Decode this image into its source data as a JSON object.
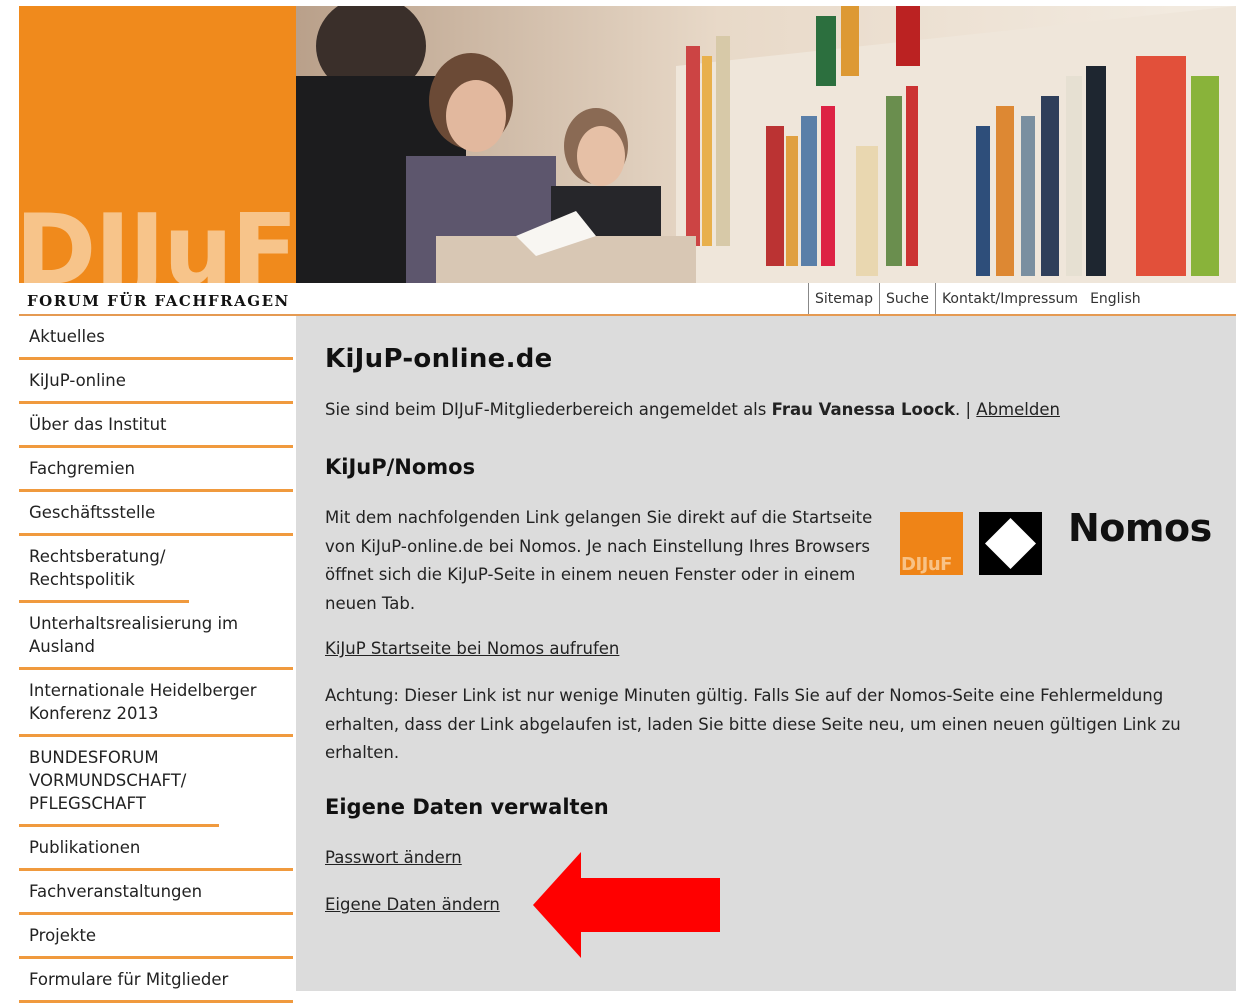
{
  "header": {
    "logo_text": "DIJuF",
    "tagline": "FORUM FÜR FACHFRAGEN",
    "topnav": [
      "Sitemap",
      "Suche",
      "Kontakt/Impressum",
      "English"
    ]
  },
  "sidebar": {
    "items": [
      {
        "label": "Aktuelles"
      },
      {
        "label": "KiJuP-online"
      },
      {
        "label": "Über das Institut"
      },
      {
        "label": "Fachgremien"
      },
      {
        "label": "Geschäftsstelle"
      },
      {
        "label": "Rechtsberatung/ Rechtspolitik"
      },
      {
        "label": "Unterhaltsrealisierung im Ausland"
      },
      {
        "label": "Internationale Heidelberger Konferenz 2013"
      },
      {
        "label": "BUNDESFORUM VORMUNDSCHAFT/ PFLEGSCHAFT"
      },
      {
        "label": "Publikationen"
      },
      {
        "label": "Fachveranstaltungen"
      },
      {
        "label": "Projekte"
      },
      {
        "label": "Formulare für Mitglieder"
      }
    ]
  },
  "main": {
    "title": "KiJuP-online.de",
    "login_prefix": "Sie sind beim DIJuF-Mitgliederbereich angemeldet als ",
    "login_user": "Frau Vanessa Loock",
    "login_sep": ". | ",
    "logout_label": "Abmelden",
    "section1_heading": "KiJuP/Nomos",
    "intro_text": "Mit dem nachfolgenden Link gelangen Sie direkt auf die Startseite von KiJuP-online.de bei Nomos. Je nach Einstellung Ihres Browsers öffnet sich die KiJuP-Seite in einem neuen Fenster oder in einem neuen Tab.",
    "nomos_link": "KiJuP Startseite bei Nomos aufrufen",
    "warning_text": "Achtung: Dieser Link ist nur wenige Minuten gültig. Falls Sie auf der Nomos-Seite eine Fehlermeldung erhalten, dass der Link abgelaufen ist, laden Sie bitte diese Seite neu, um einen neuen gültigen Link zu erhalten.",
    "section2_heading": "Eigene Daten verwalten",
    "password_link": "Passwort ändern",
    "own_data_link": "Eigene Daten ändern",
    "logos": {
      "dijuf_small": "DIJuF",
      "nomos_word": "Nomos"
    }
  },
  "colors": {
    "brand_orange": "#f08a1c",
    "content_bg": "#dcdcdc",
    "arrow": "#ff0000"
  }
}
